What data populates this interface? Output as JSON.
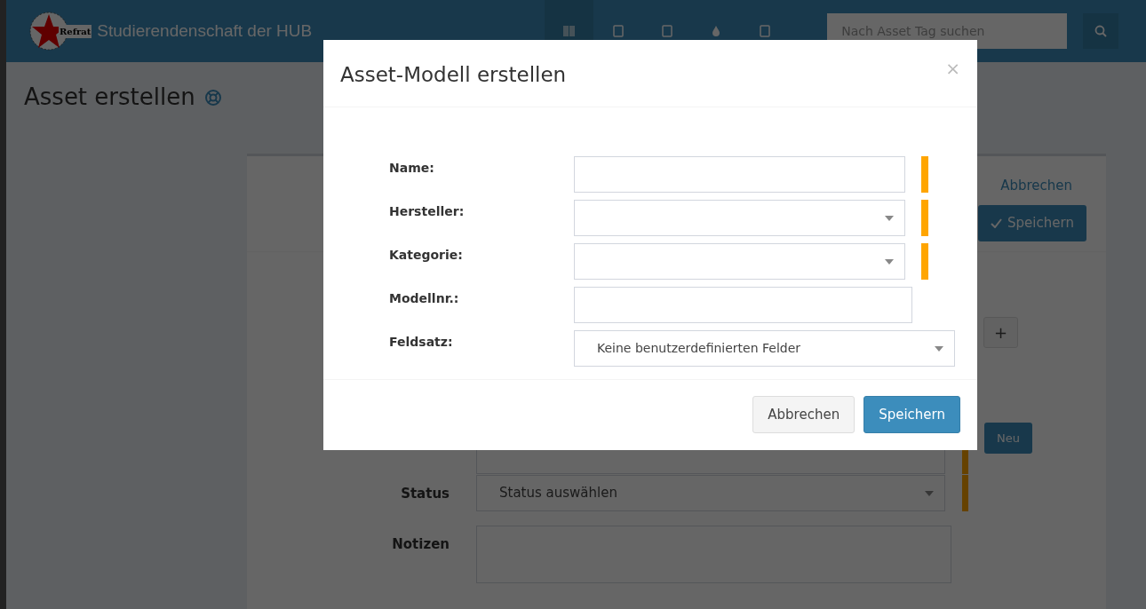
{
  "navbar": {
    "logo_text": "Refrat",
    "brand": "Studierendenschaft der HUB",
    "search": {
      "placeholder": "Nach Asset Tag suchen"
    }
  },
  "page": {
    "title": "Asset erstellen"
  },
  "card": {
    "cancel_link": "Abbrechen",
    "save_button": "Speichern",
    "add_button": "+",
    "new_button": "Neu",
    "fields": [
      {
        "kind": "select",
        "label": "Status",
        "placeholder": "Status auswählen",
        "required": true
      },
      {
        "kind": "textarea",
        "label": "Notizen",
        "required": false
      }
    ]
  },
  "modal": {
    "title": "Asset-Modell erstellen",
    "close": "×",
    "fields": [
      {
        "kind": "text",
        "label": "Name:",
        "required": true
      },
      {
        "kind": "select",
        "label": "Hersteller:",
        "required": true
      },
      {
        "kind": "select",
        "label": "Kategorie:",
        "required": true
      },
      {
        "kind": "text",
        "label": "Modellnr.:",
        "required": false
      },
      {
        "kind": "select",
        "label": "Feldsatz:",
        "value": "Keine benutzerdefinierten Felder",
        "required": false
      }
    ],
    "buttons": [
      {
        "label": "Abbrechen",
        "kind": "default"
      },
      {
        "label": "Speichern",
        "kind": "primary"
      }
    ]
  }
}
